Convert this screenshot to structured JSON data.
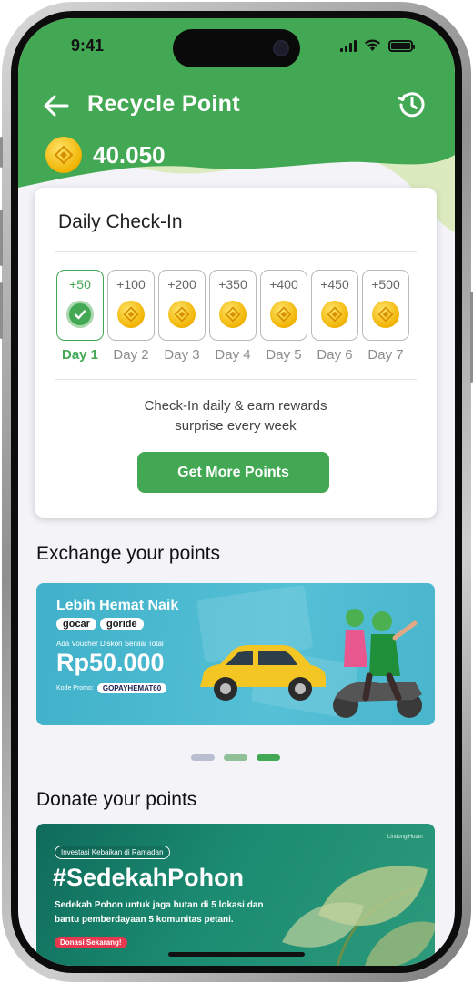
{
  "status_bar": {
    "time": "9:41"
  },
  "header": {
    "title": "Recycle Point",
    "balance": "40.050",
    "accent_color": "#43a853",
    "back_icon": "arrow-left-icon",
    "history_icon": "history-clock-icon"
  },
  "checkin": {
    "title": "Daily Check-In",
    "days": [
      {
        "points": "+50",
        "label": "Day 1",
        "status": "claimed"
      },
      {
        "points": "+100",
        "label": "Day 2",
        "status": "pending"
      },
      {
        "points": "+200",
        "label": "Day 3",
        "status": "pending"
      },
      {
        "points": "+350",
        "label": "Day 4",
        "status": "pending"
      },
      {
        "points": "+400",
        "label": "Day 5",
        "status": "pending"
      },
      {
        "points": "+450",
        "label": "Day 6",
        "status": "pending"
      },
      {
        "points": "+500",
        "label": "Day 7",
        "status": "pending"
      }
    ],
    "description_line1": "Check-In daily & earn rewards",
    "description_line2": "surprise every week",
    "cta_label": "Get More Points"
  },
  "exchange": {
    "title": "Exchange your points",
    "banner": {
      "headline": "Lebih Hemat Naik",
      "brand1": "gocar",
      "brand2": "goride",
      "subtext": "Ada Voucher Diskon Senilai Total",
      "amount": "Rp50.000",
      "promo_label": "Kode Promo:",
      "promo_code": "GOPAYHEMAT60"
    },
    "pager": {
      "count": 3,
      "active_index": 2
    }
  },
  "donate": {
    "title": "Donate your points",
    "banner": {
      "tag": "Investasi Kebaikan di Ramadan",
      "headline": "#SedekahPohon",
      "line1": "Sedekah Pohon untuk jaga hutan di 5 lokasi dan",
      "line2": "bantu pemberdayaan 5 komunitas petani.",
      "cta": "Donasi Sekarang!",
      "brand": "LindungiHutan"
    }
  }
}
